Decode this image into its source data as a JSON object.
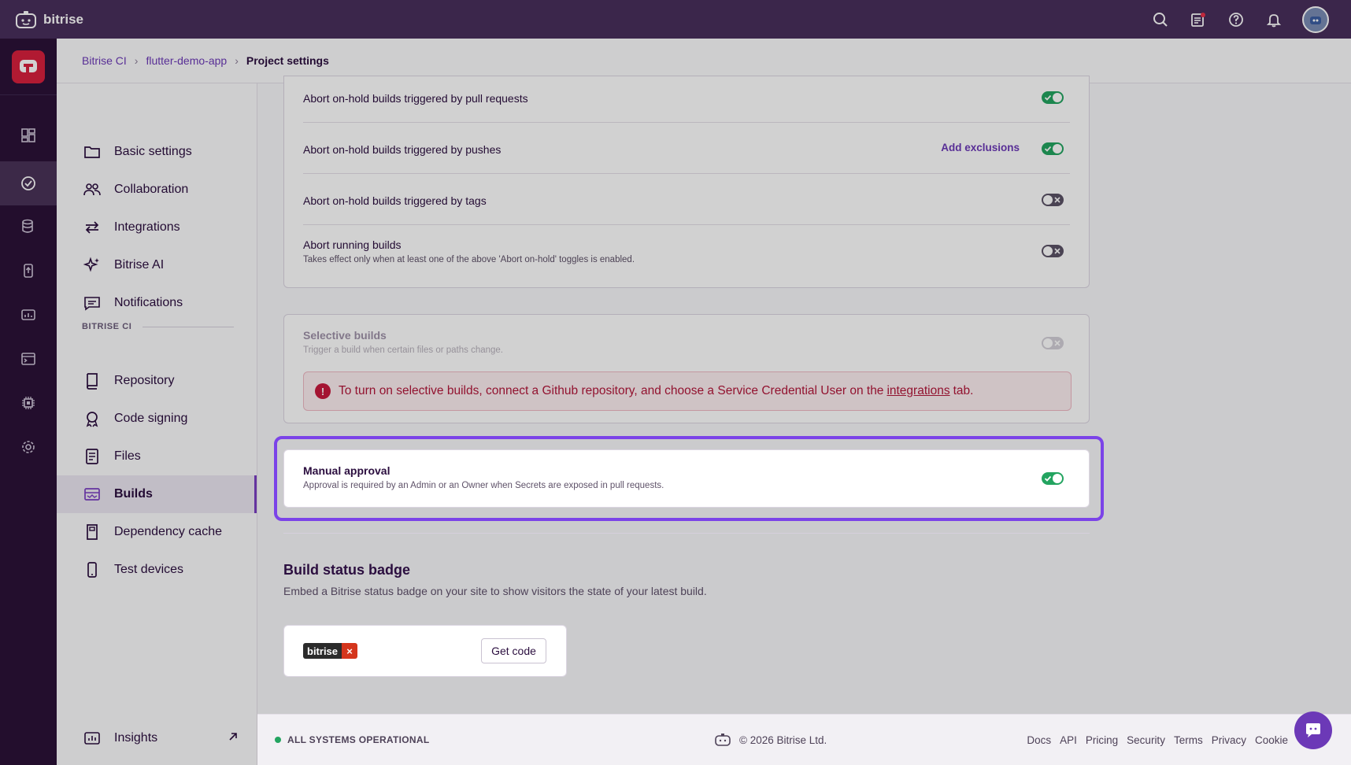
{
  "app": {
    "brand": "bitrise"
  },
  "breadcrumb": [
    "Bitrise CI",
    "flutter-demo-app",
    "Project settings"
  ],
  "sidebar": {
    "items": [
      {
        "label": "Basic settings",
        "icon": "folder-icon"
      },
      {
        "label": "Collaboration",
        "icon": "people-icon"
      },
      {
        "label": "Integrations",
        "icon": "arrows-icon"
      },
      {
        "label": "Bitrise AI",
        "icon": "sparkle-icon"
      },
      {
        "label": "Notifications",
        "icon": "chat-icon"
      }
    ],
    "section_label": "BITRISE CI",
    "ci_items": [
      {
        "label": "Repository",
        "icon": "book-icon"
      },
      {
        "label": "Code signing",
        "icon": "seal-icon"
      },
      {
        "label": "Files",
        "icon": "file-icon"
      },
      {
        "label": "Builds",
        "icon": "builds-icon",
        "active": true
      },
      {
        "label": "Dependency cache",
        "icon": "cache-icon"
      },
      {
        "label": "Test devices",
        "icon": "phone-icon"
      }
    ],
    "insights": "Insights"
  },
  "abort_settings": [
    {
      "title": "Abort on-hold builds triggered by pull requests",
      "enabled": true
    },
    {
      "title": "Abort on-hold builds triggered by pushes",
      "enabled": true,
      "action": "Add exclusions"
    },
    {
      "title": "Abort on-hold builds triggered by tags",
      "enabled": false
    },
    {
      "title": "Abort running builds",
      "subtitle": "Takes effect only when at least one of the above 'Abort on-hold' toggles is enabled.",
      "enabled": false
    }
  ],
  "selective_builds": {
    "title": "Selective builds",
    "subtitle": "Trigger a build when certain files or paths change.",
    "enabled": false,
    "alert_before": "To turn on selective builds, connect a Github repository, and choose a Service Credential User on the",
    "alert_link": "integrations",
    "alert_after": "tab."
  },
  "manual_approval": {
    "title": "Manual approval",
    "subtitle": "Approval is required by an Admin or an Owner when Secrets are exposed in pull requests.",
    "enabled": true
  },
  "badge_section": {
    "title": "Build status badge",
    "description": "Embed a Bitrise status badge on your site to show visitors the state of your latest build.",
    "badge_text": "bitrise",
    "badge_mark": "×",
    "button": "Get code"
  },
  "footer": {
    "status": "ALL SYSTEMS OPERATIONAL",
    "copyright": "© 2026 Bitrise Ltd.",
    "links": [
      "Docs",
      "API",
      "Pricing",
      "Security",
      "Terms",
      "Privacy",
      "Cookie"
    ]
  },
  "colors": {
    "brand": "#492f5c",
    "accent": "#6c39b7",
    "success": "#23a460",
    "error": "#c8193d"
  }
}
